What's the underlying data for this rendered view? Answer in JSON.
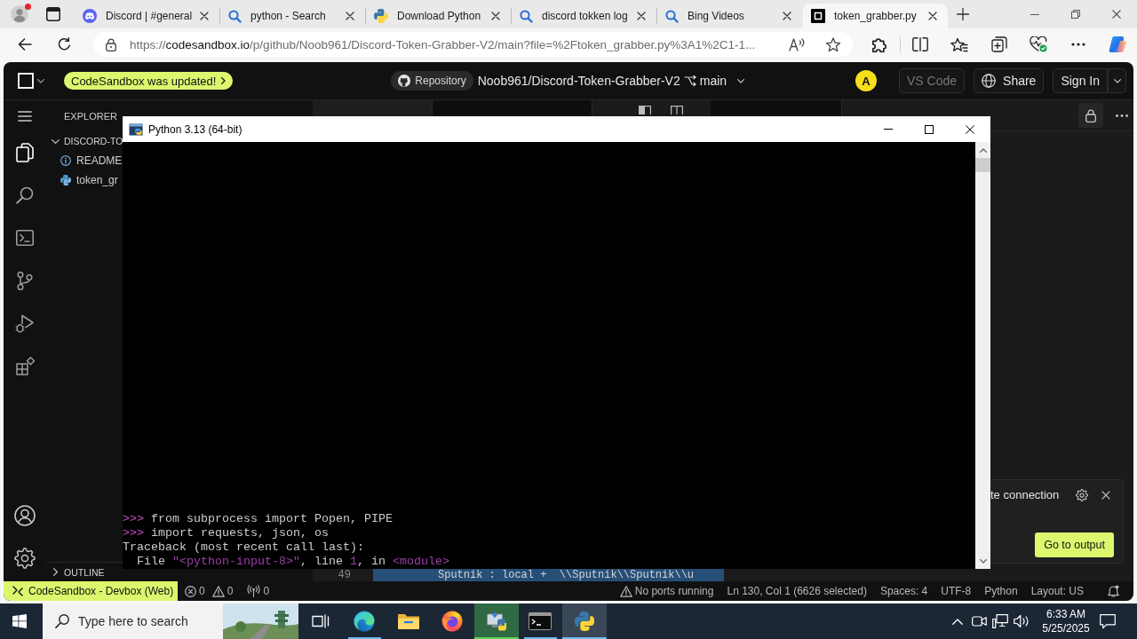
{
  "browser": {
    "tabs": [
      {
        "kind": "discord",
        "title": "Discord | #general",
        "selected": false
      },
      {
        "kind": "search",
        "title": "python - Search",
        "selected": false
      },
      {
        "kind": "python",
        "title": "Download Python",
        "selected": false
      },
      {
        "kind": "search",
        "title": "discord tokken log",
        "selected": false
      },
      {
        "kind": "search",
        "title": "Bing Videos",
        "selected": false
      },
      {
        "kind": "sandbox",
        "title": "token_grabber.py",
        "selected": true
      }
    ],
    "address": {
      "scheme": "https://",
      "host": "codesandbox.io",
      "path": "/p/github/Noob961/Discord-Token-Grabber-V2/main?file=%2Ftoken_grabber.py%3A1%2C1-1..."
    }
  },
  "sandbox": {
    "update_badge": "CodeSandbox was updated!",
    "repository_label": "Repository",
    "repository": "Noob961/Discord-Token-Grabber-V2",
    "branch": "main",
    "avatar": "A",
    "buttons": [
      {
        "kind": "vscode",
        "label": "VS Code",
        "disabled": true
      },
      {
        "kind": "share",
        "label": "Share",
        "disabled": false
      },
      {
        "kind": "signin",
        "label": "Sign In",
        "disabled": false
      }
    ],
    "activity_bar": {
      "items": [
        {
          "kind": "files",
          "selected": true
        },
        {
          "kind": "search",
          "selected": false
        },
        {
          "kind": "terminal",
          "selected": false
        },
        {
          "kind": "source-control",
          "selected": false
        },
        {
          "kind": "run",
          "selected": false
        },
        {
          "kind": "extensions",
          "selected": false
        }
      ],
      "bottom": [
        {
          "kind": "account"
        },
        {
          "kind": "settings"
        }
      ]
    },
    "explorer": {
      "title": "EXPLORER",
      "folder": {
        "name": "DISCORD-TO",
        "expanded": true,
        "children": [
          {
            "kind": "info",
            "name": "README"
          },
          {
            "kind": "python",
            "name": "token_gr"
          }
        ]
      },
      "outline": {
        "label": "OUTLINE",
        "expanded": false
      }
    },
    "editor_groups": [
      {
        "tabs": [
          {
            "selected": false
          },
          {
            "selected": true
          }
        ]
      },
      {
        "tabs": [
          {
            "selected": true
          }
        ]
      }
    ],
    "editor_line": {
      "number": "49",
      "code": "Sputnik : local +  \\\\Sputnik\\\\Sputnik\\\\u"
    },
    "notification": {
      "message": "te connection",
      "action": "Go to output"
    },
    "status_bar": {
      "remote": "CodeSandbox - Devbox (Web)",
      "left": [
        {
          "kind": "errors",
          "text": "0"
        },
        {
          "kind": "warnings",
          "text": "0"
        },
        {
          "kind": "ports",
          "text": "0"
        }
      ],
      "right": [
        {
          "kind": "ports-warning",
          "text": "No ports running"
        },
        {
          "kind": "plain",
          "text": "Ln 130, Col 1 (6626 selected)"
        },
        {
          "kind": "plain",
          "text": "Spaces: 4"
        },
        {
          "kind": "plain",
          "text": "UTF-8"
        },
        {
          "kind": "plain",
          "text": "Python"
        },
        {
          "kind": "plain",
          "text": "Layout: US"
        },
        {
          "kind": "feedback"
        }
      ]
    }
  },
  "console_window": {
    "title": "Python 3.13 (64-bit)",
    "lines": [
      {
        "segments": [
          {
            "kind": "prompt",
            "text": ">>>"
          },
          {
            "kind": "plain",
            "text": " from subprocess import Popen, PIPE"
          }
        ]
      },
      {
        "segments": [
          {
            "kind": "prompt",
            "text": ">>>"
          },
          {
            "kind": "plain",
            "text": " import requests, json, os"
          }
        ]
      },
      {
        "segments": [
          {
            "kind": "plain",
            "text": "Traceback (most recent call last):"
          }
        ]
      },
      {
        "segments": [
          {
            "kind": "plain",
            "text": "  File "
          },
          {
            "kind": "accent",
            "text": "\"<python-input-8>\""
          },
          {
            "kind": "plain",
            "text": ", line "
          },
          {
            "kind": "accent",
            "text": "1"
          },
          {
            "kind": "plain",
            "text": ", in "
          },
          {
            "kind": "accent",
            "text": "<module>"
          }
        ]
      }
    ]
  },
  "taskbar": {
    "search_placeholder": "Type here to search",
    "apps": [
      {
        "kind": "task-view",
        "running": false,
        "selected": false,
        "attention": false
      },
      {
        "kind": "edge",
        "running": true,
        "selected": false,
        "attention": false
      },
      {
        "kind": "explorer",
        "running": false,
        "selected": false,
        "attention": false
      },
      {
        "kind": "firefox",
        "running": false,
        "selected": false,
        "attention": false
      },
      {
        "kind": "installer",
        "running": true,
        "selected": false,
        "attention": true
      },
      {
        "kind": "terminal",
        "running": true,
        "selected": false,
        "attention": false
      },
      {
        "kind": "python",
        "running": true,
        "selected": true,
        "attention": false
      }
    ],
    "time": "6:33 AM",
    "date": "5/25/2025"
  }
}
